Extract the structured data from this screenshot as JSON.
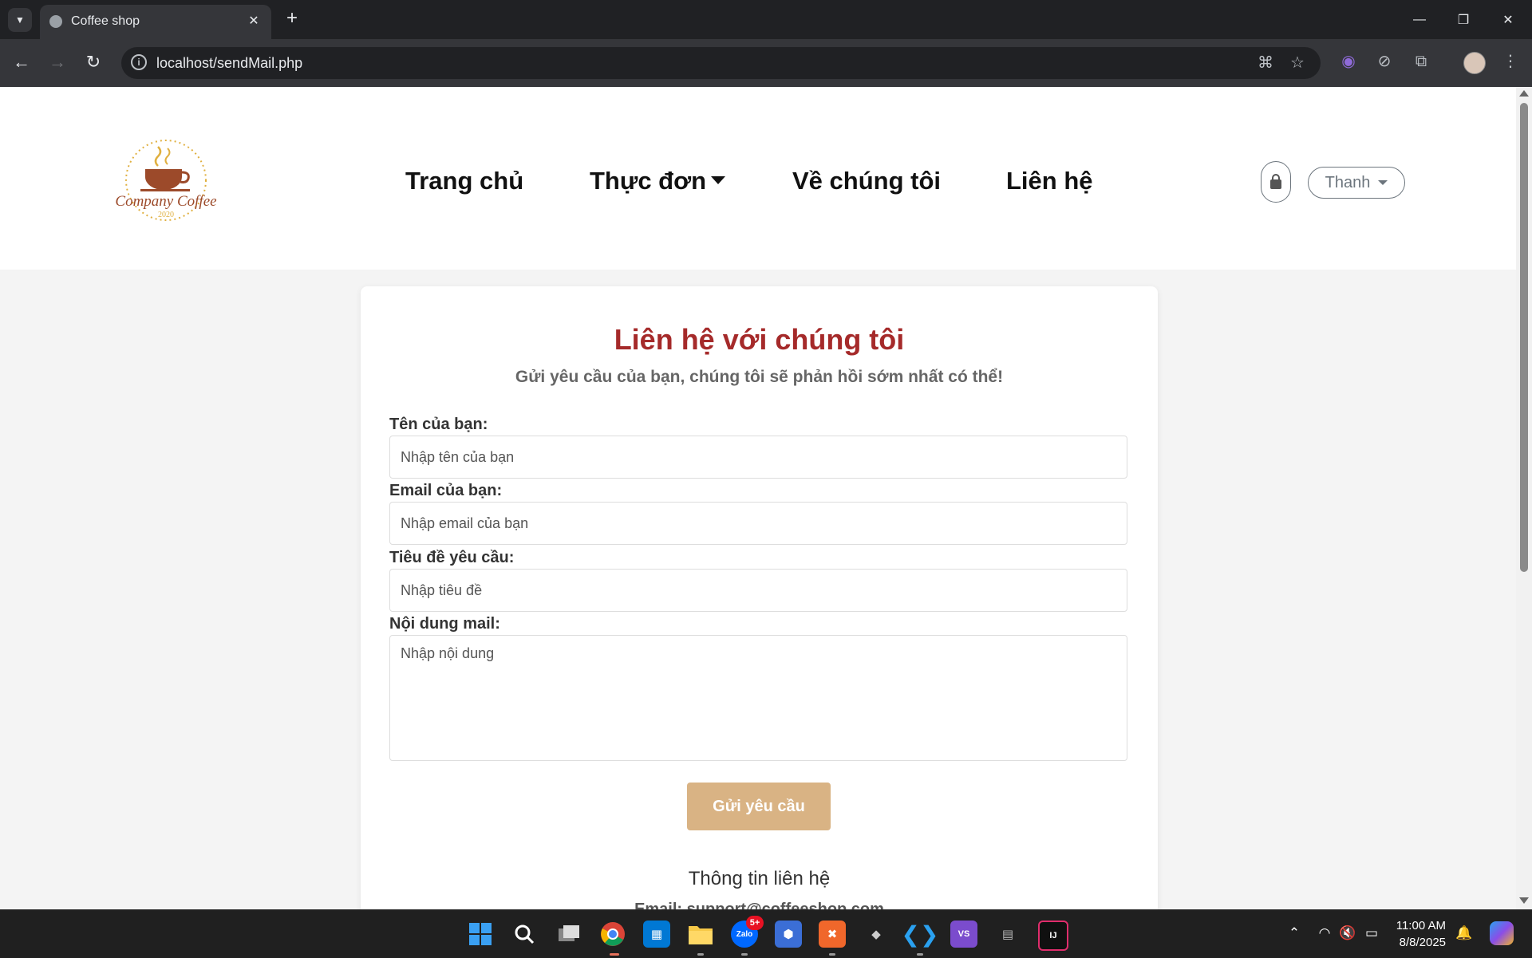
{
  "browser": {
    "tab_title": "Coffee shop",
    "new_tab_symbol": "+",
    "url": "localhost/sendMail.php",
    "window_controls": {
      "minimize": "—",
      "restore": "❐",
      "close": "✕"
    }
  },
  "site": {
    "logo_text": "Company Coffee",
    "logo_year": "2020",
    "nav": {
      "home": "Trang chủ",
      "menu": "Thực đơn",
      "about": "Về chúng tôi",
      "contact": "Liên hệ"
    },
    "user_name": "Thanh"
  },
  "form": {
    "title": "Liên hệ với chúng tôi",
    "subtitle": "Gửi yêu cầu của bạn, chúng tôi sẽ phản hồi sớm nhất có thể!",
    "name_label": "Tên của bạn:",
    "name_placeholder": "Nhập tên của bạn",
    "email_label": "Email của bạn:",
    "email_placeholder": "Nhập email của bạn",
    "subject_label": "Tiêu đề yêu cầu:",
    "subject_placeholder": "Nhập tiêu đề",
    "content_label": "Nội dung mail:",
    "content_placeholder": "Nhập nội dung",
    "submit_label": "Gửi yêu cầu",
    "contact_info_title": "Thông tin liên hệ",
    "contact_email": "Email: support@coffeeshop.com"
  },
  "taskbar": {
    "zalo_label": "Zalo",
    "zalo_badge": "5+",
    "clock_time": "11:00 AM",
    "clock_date": "8/8/2025"
  },
  "colors": {
    "heading": "#a52a2a",
    "button": "#d9b384",
    "chrome_dark": "#202124",
    "chrome_toolbar": "#35363a"
  }
}
